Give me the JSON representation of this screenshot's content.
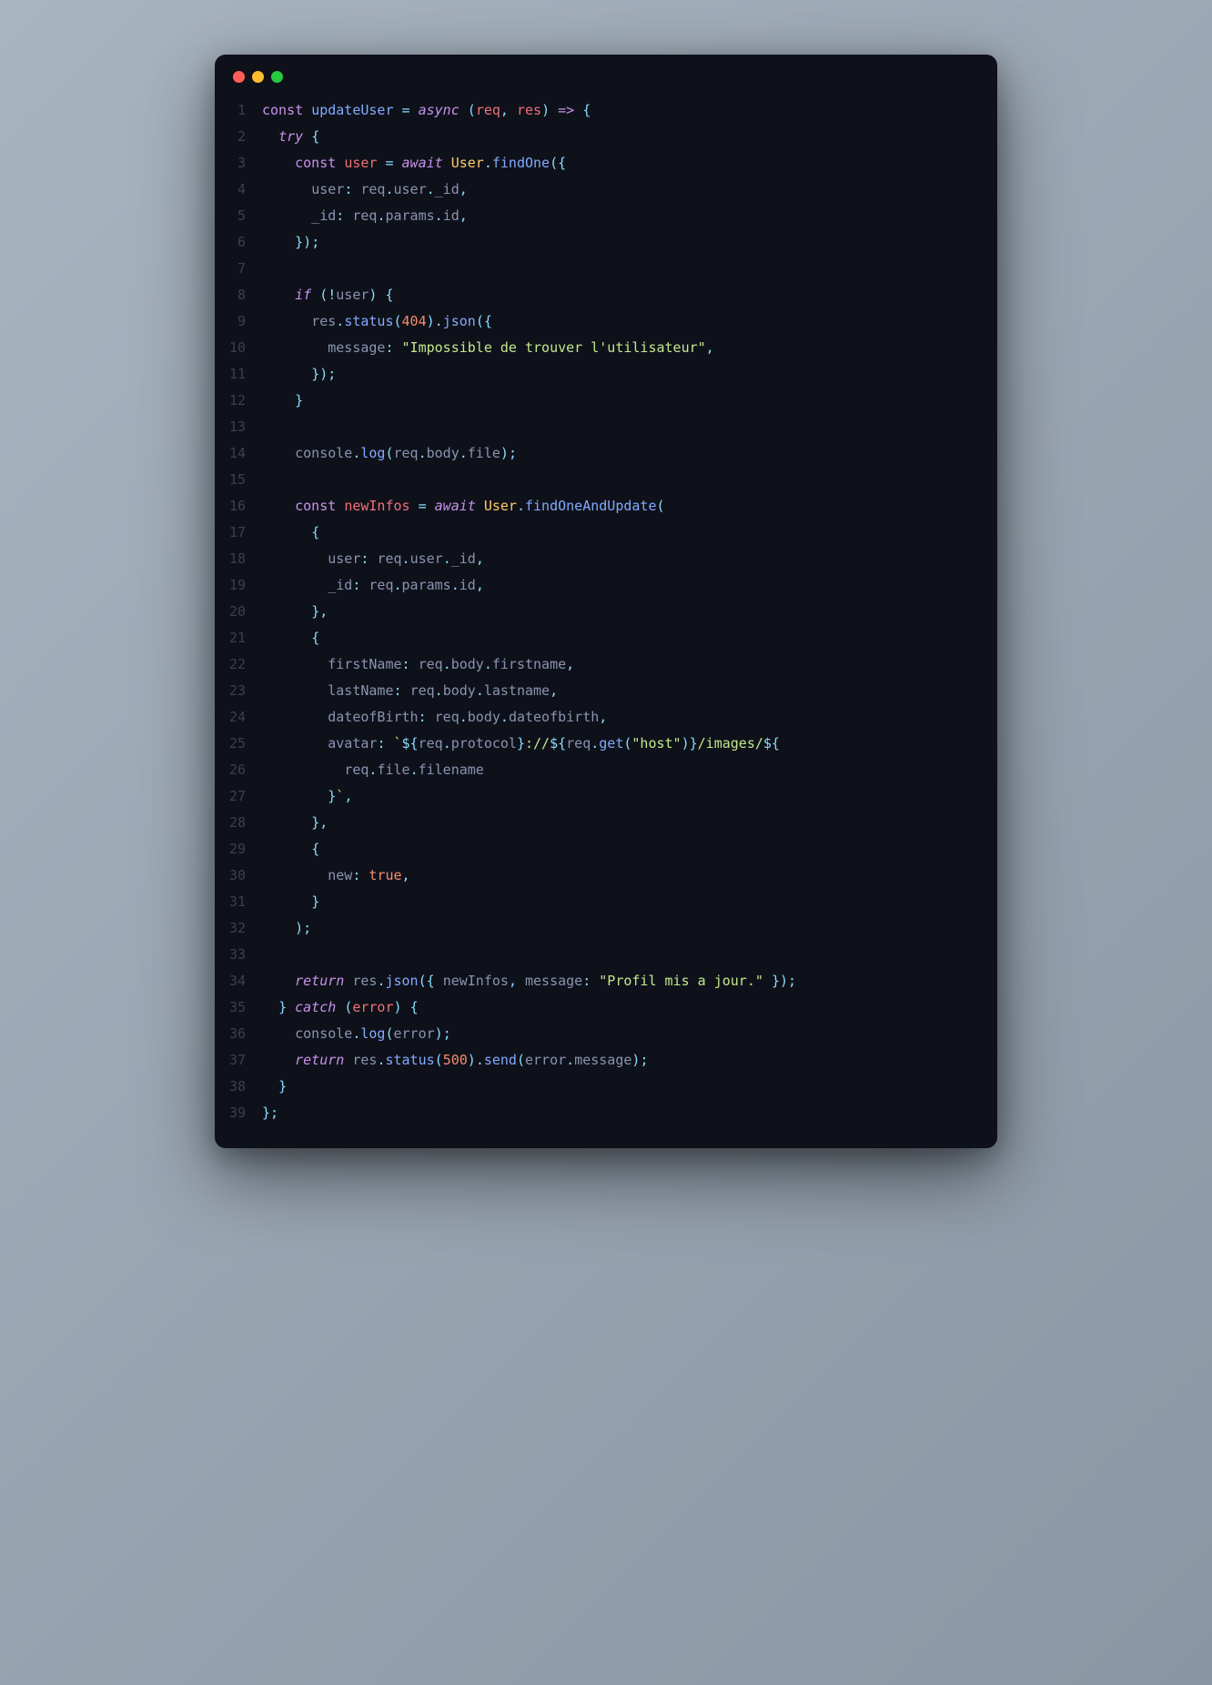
{
  "window": {
    "dots": [
      "red",
      "yellow",
      "green"
    ]
  },
  "lines": [
    {
      "n": "1",
      "tokens": [
        {
          "t": "const ",
          "c": "kw2"
        },
        {
          "t": "updateUser",
          "c": "fn"
        },
        {
          "t": " ",
          "c": "op"
        },
        {
          "t": "=",
          "c": "op"
        },
        {
          "t": " ",
          "c": ""
        },
        {
          "t": "async",
          "c": "kw"
        },
        {
          "t": " ",
          "c": ""
        },
        {
          "t": "(",
          "c": "op"
        },
        {
          "t": "req",
          "c": "var"
        },
        {
          "t": ",",
          "c": "op"
        },
        {
          "t": " ",
          "c": ""
        },
        {
          "t": "res",
          "c": "var"
        },
        {
          "t": ")",
          "c": "op"
        },
        {
          "t": " ",
          "c": ""
        },
        {
          "t": "=>",
          "c": "kw2"
        },
        {
          "t": " ",
          "c": ""
        },
        {
          "t": "{",
          "c": "op"
        }
      ]
    },
    {
      "n": "2",
      "tokens": [
        {
          "t": "  ",
          "c": ""
        },
        {
          "t": "try",
          "c": "kw"
        },
        {
          "t": " ",
          "c": ""
        },
        {
          "t": "{",
          "c": "op"
        }
      ]
    },
    {
      "n": "3",
      "tokens": [
        {
          "t": "    ",
          "c": ""
        },
        {
          "t": "const ",
          "c": "kw2"
        },
        {
          "t": "user",
          "c": "var"
        },
        {
          "t": " ",
          "c": ""
        },
        {
          "t": "=",
          "c": "op"
        },
        {
          "t": " ",
          "c": ""
        },
        {
          "t": "await",
          "c": "kw"
        },
        {
          "t": " ",
          "c": ""
        },
        {
          "t": "User",
          "c": "obj"
        },
        {
          "t": ".",
          "c": "op"
        },
        {
          "t": "findOne",
          "c": "fn"
        },
        {
          "t": "(",
          "c": "op"
        },
        {
          "t": "{",
          "c": "op"
        }
      ]
    },
    {
      "n": "4",
      "tokens": [
        {
          "t": "      ",
          "c": ""
        },
        {
          "t": "user",
          "c": "ident"
        },
        {
          "t": ":",
          "c": "op"
        },
        {
          "t": " ",
          "c": ""
        },
        {
          "t": "req",
          "c": "ident"
        },
        {
          "t": ".",
          "c": "op"
        },
        {
          "t": "user",
          "c": "ident"
        },
        {
          "t": ".",
          "c": "op"
        },
        {
          "t": "_id",
          "c": "ident"
        },
        {
          "t": ",",
          "c": "op"
        }
      ]
    },
    {
      "n": "5",
      "tokens": [
        {
          "t": "      ",
          "c": ""
        },
        {
          "t": "_id",
          "c": "ident"
        },
        {
          "t": ":",
          "c": "op"
        },
        {
          "t": " ",
          "c": ""
        },
        {
          "t": "req",
          "c": "ident"
        },
        {
          "t": ".",
          "c": "op"
        },
        {
          "t": "params",
          "c": "ident"
        },
        {
          "t": ".",
          "c": "op"
        },
        {
          "t": "id",
          "c": "ident"
        },
        {
          "t": ",",
          "c": "op"
        }
      ]
    },
    {
      "n": "6",
      "tokens": [
        {
          "t": "    ",
          "c": ""
        },
        {
          "t": "}",
          "c": "op"
        },
        {
          "t": ")",
          "c": "op"
        },
        {
          "t": ";",
          "c": "op"
        }
      ]
    },
    {
      "n": "7",
      "tokens": []
    },
    {
      "n": "8",
      "tokens": [
        {
          "t": "    ",
          "c": ""
        },
        {
          "t": "if",
          "c": "kw"
        },
        {
          "t": " ",
          "c": ""
        },
        {
          "t": "(",
          "c": "op"
        },
        {
          "t": "!",
          "c": "op"
        },
        {
          "t": "user",
          "c": "ident"
        },
        {
          "t": ")",
          "c": "op"
        },
        {
          "t": " ",
          "c": ""
        },
        {
          "t": "{",
          "c": "op"
        }
      ]
    },
    {
      "n": "9",
      "tokens": [
        {
          "t": "      ",
          "c": ""
        },
        {
          "t": "res",
          "c": "ident"
        },
        {
          "t": ".",
          "c": "op"
        },
        {
          "t": "status",
          "c": "fn"
        },
        {
          "t": "(",
          "c": "op"
        },
        {
          "t": "404",
          "c": "num"
        },
        {
          "t": ")",
          "c": "op"
        },
        {
          "t": ".",
          "c": "op"
        },
        {
          "t": "json",
          "c": "fn"
        },
        {
          "t": "(",
          "c": "op"
        },
        {
          "t": "{",
          "c": "op"
        }
      ]
    },
    {
      "n": "10",
      "tokens": [
        {
          "t": "        ",
          "c": ""
        },
        {
          "t": "message",
          "c": "ident"
        },
        {
          "t": ":",
          "c": "op"
        },
        {
          "t": " ",
          "c": ""
        },
        {
          "t": "\"Impossible de trouver l'utilisateur\"",
          "c": "str"
        },
        {
          "t": ",",
          "c": "op"
        }
      ]
    },
    {
      "n": "11",
      "tokens": [
        {
          "t": "      ",
          "c": ""
        },
        {
          "t": "}",
          "c": "op"
        },
        {
          "t": ")",
          "c": "op"
        },
        {
          "t": ";",
          "c": "op"
        }
      ]
    },
    {
      "n": "12",
      "tokens": [
        {
          "t": "    ",
          "c": ""
        },
        {
          "t": "}",
          "c": "op"
        }
      ]
    },
    {
      "n": "13",
      "tokens": []
    },
    {
      "n": "14",
      "tokens": [
        {
          "t": "    ",
          "c": ""
        },
        {
          "t": "console",
          "c": "ident"
        },
        {
          "t": ".",
          "c": "op"
        },
        {
          "t": "log",
          "c": "fn"
        },
        {
          "t": "(",
          "c": "op"
        },
        {
          "t": "req",
          "c": "ident"
        },
        {
          "t": ".",
          "c": "op"
        },
        {
          "t": "body",
          "c": "ident"
        },
        {
          "t": ".",
          "c": "op"
        },
        {
          "t": "file",
          "c": "ident"
        },
        {
          "t": ")",
          "c": "op"
        },
        {
          "t": ";",
          "c": "op"
        }
      ]
    },
    {
      "n": "15",
      "tokens": []
    },
    {
      "n": "16",
      "tokens": [
        {
          "t": "    ",
          "c": ""
        },
        {
          "t": "const ",
          "c": "kw2"
        },
        {
          "t": "newInfos",
          "c": "var"
        },
        {
          "t": " ",
          "c": ""
        },
        {
          "t": "=",
          "c": "op"
        },
        {
          "t": " ",
          "c": ""
        },
        {
          "t": "await",
          "c": "kw"
        },
        {
          "t": " ",
          "c": ""
        },
        {
          "t": "User",
          "c": "obj"
        },
        {
          "t": ".",
          "c": "op"
        },
        {
          "t": "findOneAndUpdate",
          "c": "fn"
        },
        {
          "t": "(",
          "c": "op"
        }
      ]
    },
    {
      "n": "17",
      "tokens": [
        {
          "t": "      ",
          "c": ""
        },
        {
          "t": "{",
          "c": "op"
        }
      ]
    },
    {
      "n": "18",
      "tokens": [
        {
          "t": "        ",
          "c": ""
        },
        {
          "t": "user",
          "c": "ident"
        },
        {
          "t": ":",
          "c": "op"
        },
        {
          "t": " ",
          "c": ""
        },
        {
          "t": "req",
          "c": "ident"
        },
        {
          "t": ".",
          "c": "op"
        },
        {
          "t": "user",
          "c": "ident"
        },
        {
          "t": ".",
          "c": "op"
        },
        {
          "t": "_id",
          "c": "ident"
        },
        {
          "t": ",",
          "c": "op"
        }
      ]
    },
    {
      "n": "19",
      "tokens": [
        {
          "t": "        ",
          "c": ""
        },
        {
          "t": "_id",
          "c": "ident"
        },
        {
          "t": ":",
          "c": "op"
        },
        {
          "t": " ",
          "c": ""
        },
        {
          "t": "req",
          "c": "ident"
        },
        {
          "t": ".",
          "c": "op"
        },
        {
          "t": "params",
          "c": "ident"
        },
        {
          "t": ".",
          "c": "op"
        },
        {
          "t": "id",
          "c": "ident"
        },
        {
          "t": ",",
          "c": "op"
        }
      ]
    },
    {
      "n": "20",
      "tokens": [
        {
          "t": "      ",
          "c": ""
        },
        {
          "t": "}",
          "c": "op"
        },
        {
          "t": ",",
          "c": "op"
        }
      ]
    },
    {
      "n": "21",
      "tokens": [
        {
          "t": "      ",
          "c": ""
        },
        {
          "t": "{",
          "c": "op"
        }
      ]
    },
    {
      "n": "22",
      "tokens": [
        {
          "t": "        ",
          "c": ""
        },
        {
          "t": "firstName",
          "c": "ident"
        },
        {
          "t": ":",
          "c": "op"
        },
        {
          "t": " ",
          "c": ""
        },
        {
          "t": "req",
          "c": "ident"
        },
        {
          "t": ".",
          "c": "op"
        },
        {
          "t": "body",
          "c": "ident"
        },
        {
          "t": ".",
          "c": "op"
        },
        {
          "t": "firstname",
          "c": "ident"
        },
        {
          "t": ",",
          "c": "op"
        }
      ]
    },
    {
      "n": "23",
      "tokens": [
        {
          "t": "        ",
          "c": ""
        },
        {
          "t": "lastName",
          "c": "ident"
        },
        {
          "t": ":",
          "c": "op"
        },
        {
          "t": " ",
          "c": ""
        },
        {
          "t": "req",
          "c": "ident"
        },
        {
          "t": ".",
          "c": "op"
        },
        {
          "t": "body",
          "c": "ident"
        },
        {
          "t": ".",
          "c": "op"
        },
        {
          "t": "lastname",
          "c": "ident"
        },
        {
          "t": ",",
          "c": "op"
        }
      ]
    },
    {
      "n": "24",
      "tokens": [
        {
          "t": "        ",
          "c": ""
        },
        {
          "t": "dateofBirth",
          "c": "ident"
        },
        {
          "t": ":",
          "c": "op"
        },
        {
          "t": " ",
          "c": ""
        },
        {
          "t": "req",
          "c": "ident"
        },
        {
          "t": ".",
          "c": "op"
        },
        {
          "t": "body",
          "c": "ident"
        },
        {
          "t": ".",
          "c": "op"
        },
        {
          "t": "dateofbirth",
          "c": "ident"
        },
        {
          "t": ",",
          "c": "op"
        }
      ]
    },
    {
      "n": "25",
      "tokens": [
        {
          "t": "        ",
          "c": ""
        },
        {
          "t": "avatar",
          "c": "ident"
        },
        {
          "t": ":",
          "c": "op"
        },
        {
          "t": " ",
          "c": ""
        },
        {
          "t": "`",
          "c": "str"
        },
        {
          "t": "${",
          "c": "tmpl"
        },
        {
          "t": "req",
          "c": "ident"
        },
        {
          "t": ".",
          "c": "op"
        },
        {
          "t": "protocol",
          "c": "ident"
        },
        {
          "t": "}",
          "c": "tmpl"
        },
        {
          "t": "://",
          "c": "str"
        },
        {
          "t": "${",
          "c": "tmpl"
        },
        {
          "t": "req",
          "c": "ident"
        },
        {
          "t": ".",
          "c": "op"
        },
        {
          "t": "get",
          "c": "fn"
        },
        {
          "t": "(",
          "c": "op"
        },
        {
          "t": "\"host\"",
          "c": "str"
        },
        {
          "t": ")",
          "c": "op"
        },
        {
          "t": "}",
          "c": "tmpl"
        },
        {
          "t": "/images/",
          "c": "str"
        },
        {
          "t": "${",
          "c": "tmpl"
        }
      ]
    },
    {
      "n": "26",
      "tokens": [
        {
          "t": "          ",
          "c": ""
        },
        {
          "t": "req",
          "c": "ident"
        },
        {
          "t": ".",
          "c": "op"
        },
        {
          "t": "file",
          "c": "ident"
        },
        {
          "t": ".",
          "c": "op"
        },
        {
          "t": "filename",
          "c": "ident"
        }
      ]
    },
    {
      "n": "27",
      "tokens": [
        {
          "t": "        ",
          "c": ""
        },
        {
          "t": "}",
          "c": "tmpl"
        },
        {
          "t": "`",
          "c": "str"
        },
        {
          "t": ",",
          "c": "op"
        }
      ]
    },
    {
      "n": "28",
      "tokens": [
        {
          "t": "      ",
          "c": ""
        },
        {
          "t": "}",
          "c": "op"
        },
        {
          "t": ",",
          "c": "op"
        }
      ]
    },
    {
      "n": "29",
      "tokens": [
        {
          "t": "      ",
          "c": ""
        },
        {
          "t": "{",
          "c": "op"
        }
      ]
    },
    {
      "n": "30",
      "tokens": [
        {
          "t": "        ",
          "c": ""
        },
        {
          "t": "new",
          "c": "ident"
        },
        {
          "t": ":",
          "c": "op"
        },
        {
          "t": " ",
          "c": ""
        },
        {
          "t": "true",
          "c": "bool"
        },
        {
          "t": ",",
          "c": "op"
        }
      ]
    },
    {
      "n": "31",
      "tokens": [
        {
          "t": "      ",
          "c": ""
        },
        {
          "t": "}",
          "c": "op"
        }
      ]
    },
    {
      "n": "32",
      "tokens": [
        {
          "t": "    ",
          "c": ""
        },
        {
          "t": ")",
          "c": "op"
        },
        {
          "t": ";",
          "c": "op"
        }
      ]
    },
    {
      "n": "33",
      "tokens": []
    },
    {
      "n": "34",
      "tokens": [
        {
          "t": "    ",
          "c": ""
        },
        {
          "t": "return",
          "c": "kw"
        },
        {
          "t": " ",
          "c": ""
        },
        {
          "t": "res",
          "c": "ident"
        },
        {
          "t": ".",
          "c": "op"
        },
        {
          "t": "json",
          "c": "fn"
        },
        {
          "t": "(",
          "c": "op"
        },
        {
          "t": "{",
          "c": "op"
        },
        {
          "t": " ",
          "c": ""
        },
        {
          "t": "newInfos",
          "c": "ident"
        },
        {
          "t": ",",
          "c": "op"
        },
        {
          "t": " ",
          "c": ""
        },
        {
          "t": "message",
          "c": "ident"
        },
        {
          "t": ":",
          "c": "op"
        },
        {
          "t": " ",
          "c": ""
        },
        {
          "t": "\"Profil mis a jour.\"",
          "c": "str"
        },
        {
          "t": " ",
          "c": ""
        },
        {
          "t": "}",
          "c": "op"
        },
        {
          "t": ")",
          "c": "op"
        },
        {
          "t": ";",
          "c": "op"
        }
      ]
    },
    {
      "n": "35",
      "tokens": [
        {
          "t": "  ",
          "c": ""
        },
        {
          "t": "}",
          "c": "op"
        },
        {
          "t": " ",
          "c": ""
        },
        {
          "t": "catch",
          "c": "kw"
        },
        {
          "t": " ",
          "c": ""
        },
        {
          "t": "(",
          "c": "op"
        },
        {
          "t": "error",
          "c": "var"
        },
        {
          "t": ")",
          "c": "op"
        },
        {
          "t": " ",
          "c": ""
        },
        {
          "t": "{",
          "c": "op"
        }
      ]
    },
    {
      "n": "36",
      "tokens": [
        {
          "t": "    ",
          "c": ""
        },
        {
          "t": "console",
          "c": "ident"
        },
        {
          "t": ".",
          "c": "op"
        },
        {
          "t": "log",
          "c": "fn"
        },
        {
          "t": "(",
          "c": "op"
        },
        {
          "t": "error",
          "c": "ident"
        },
        {
          "t": ")",
          "c": "op"
        },
        {
          "t": ";",
          "c": "op"
        }
      ]
    },
    {
      "n": "37",
      "tokens": [
        {
          "t": "    ",
          "c": ""
        },
        {
          "t": "return",
          "c": "kw"
        },
        {
          "t": " ",
          "c": ""
        },
        {
          "t": "res",
          "c": "ident"
        },
        {
          "t": ".",
          "c": "op"
        },
        {
          "t": "status",
          "c": "fn"
        },
        {
          "t": "(",
          "c": "op"
        },
        {
          "t": "500",
          "c": "num"
        },
        {
          "t": ")",
          "c": "op"
        },
        {
          "t": ".",
          "c": "op"
        },
        {
          "t": "send",
          "c": "fn"
        },
        {
          "t": "(",
          "c": "op"
        },
        {
          "t": "error",
          "c": "ident"
        },
        {
          "t": ".",
          "c": "op"
        },
        {
          "t": "message",
          "c": "ident"
        },
        {
          "t": ")",
          "c": "op"
        },
        {
          "t": ";",
          "c": "op"
        }
      ]
    },
    {
      "n": "38",
      "tokens": [
        {
          "t": "  ",
          "c": ""
        },
        {
          "t": "}",
          "c": "op"
        }
      ]
    },
    {
      "n": "39",
      "tokens": [
        {
          "t": "}",
          "c": "op"
        },
        {
          "t": ";",
          "c": "op"
        }
      ]
    }
  ]
}
